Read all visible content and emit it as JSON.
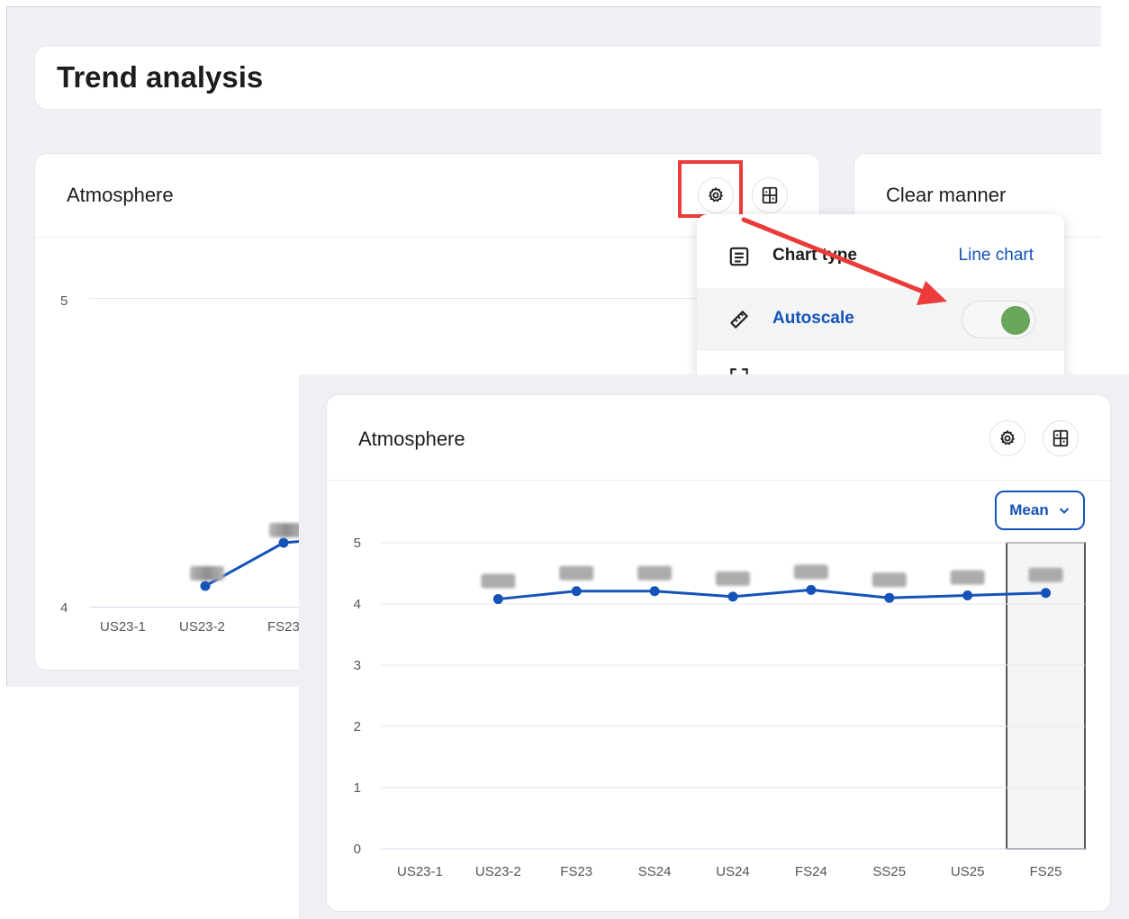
{
  "header": {
    "title": "Trend analysis"
  },
  "cards": {
    "left_title": "Atmosphere",
    "right_title": "Clear manner"
  },
  "menu": {
    "items": [
      {
        "label": "Chart type",
        "value": "Line chart",
        "icon": "list-alt-icon"
      },
      {
        "label": "Autoscale",
        "icon": "ruler-icon",
        "toggle_on": true
      }
    ]
  },
  "bg_chart": {
    "y_ticks": [
      "5",
      "4"
    ],
    "x_labels": [
      "US23-1",
      "US23-2",
      "FS23"
    ]
  },
  "fg": {
    "title": "Atmosphere",
    "aggregation_select": "Mean"
  },
  "colors": {
    "accent_blue": "#1553b8",
    "line_blue": "#1553b8",
    "toggle_green": "#6aa65a",
    "highlight_red": "#ec3b3b"
  },
  "chart_data": {
    "type": "line",
    "categories": [
      "US23-1",
      "US23-2",
      "FS23",
      "SS24",
      "US24",
      "FS24",
      "SS25",
      "US25",
      "FS25"
    ],
    "series": [
      {
        "values": [
          null,
          4.08,
          4.21,
          4.21,
          4.12,
          4.23,
          4.1,
          4.14,
          4.18
        ]
      }
    ],
    "y_ticks": [
      "0",
      "1",
      "2",
      "3",
      "4",
      "5"
    ],
    "ylim": [
      0,
      5
    ],
    "grid": true,
    "highlighted_category": "FS25",
    "data_labels": "obscured"
  }
}
